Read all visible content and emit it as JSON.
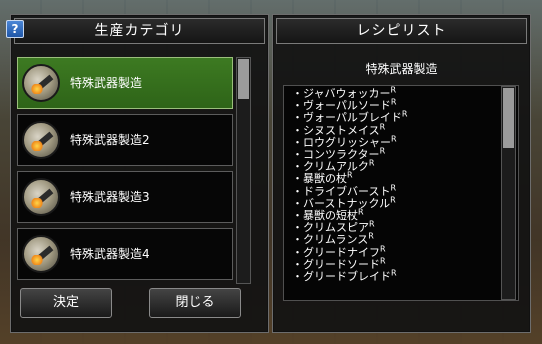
{
  "left_panel": {
    "title": "生産カテゴリ",
    "help_label": "?",
    "categories": [
      {
        "label": "特殊武器製造",
        "selected": true
      },
      {
        "label": "特殊武器製造2",
        "selected": false
      },
      {
        "label": "特殊武器製造3",
        "selected": false
      },
      {
        "label": "特殊武器製造4",
        "selected": false
      }
    ],
    "decide_label": "決定",
    "close_label": "閉じる"
  },
  "right_panel": {
    "title": "レシピリスト",
    "subtitle": "特殊武器製造",
    "bullet": "・",
    "rank_mark": "R",
    "recipes": [
      "ジャバウォッカー",
      "ヴォーパルソード",
      "ヴォーパルブレイド",
      "シヌストメイス",
      "ロウグリッシャー",
      "コンツラクター",
      "クリムアルク",
      "暴獣の杖",
      "ドライブバースト",
      "バーストナックル",
      "暴獣の短杖",
      "クリムスピア",
      "クリムランス",
      "グリードナイフ",
      "グリードソード",
      "グリードブレイド"
    ]
  },
  "colors": {
    "selected_item": "#3d7a22",
    "panel_bg": "#121212"
  }
}
